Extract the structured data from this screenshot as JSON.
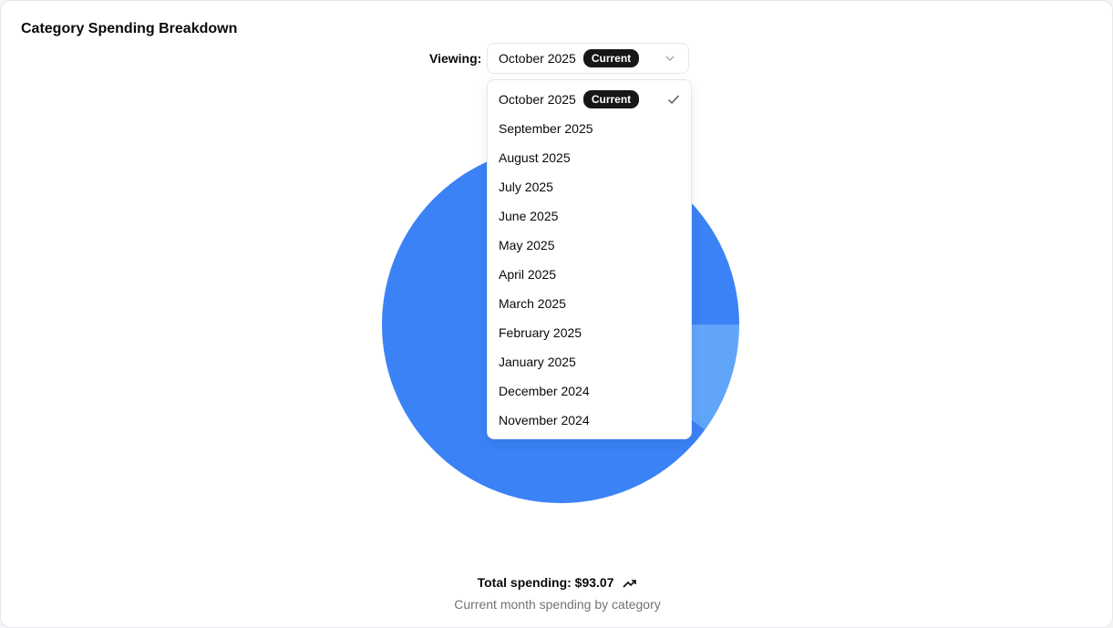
{
  "card": {
    "title": "Category Spending Breakdown"
  },
  "period_select": {
    "label": "Viewing:",
    "selected_value": "October 2025",
    "badge": "Current",
    "chevron_icon": "chevron-down-icon"
  },
  "menu": {
    "options": [
      {
        "label": "October 2025",
        "badge": "Current",
        "selected": true
      },
      {
        "label": "September 2025"
      },
      {
        "label": "August 2025"
      },
      {
        "label": "July 2025"
      },
      {
        "label": "June 2025"
      },
      {
        "label": "May 2025"
      },
      {
        "label": "April 2025"
      },
      {
        "label": "March 2025"
      },
      {
        "label": "February 2025"
      },
      {
        "label": "January 2025"
      },
      {
        "label": "December 2024"
      },
      {
        "label": "November 2024"
      }
    ],
    "check_icon": "check-icon"
  },
  "footer": {
    "total": "Total spending: $93.07",
    "trend_icon": "trending-up-icon",
    "subtitle": "Current month spending by category"
  },
  "chart_data": {
    "type": "pie",
    "slices": [
      {
        "value": 0.9,
        "color": "#3b82f6"
      },
      {
        "value": 0.1,
        "color": "#60a5fa"
      }
    ]
  }
}
